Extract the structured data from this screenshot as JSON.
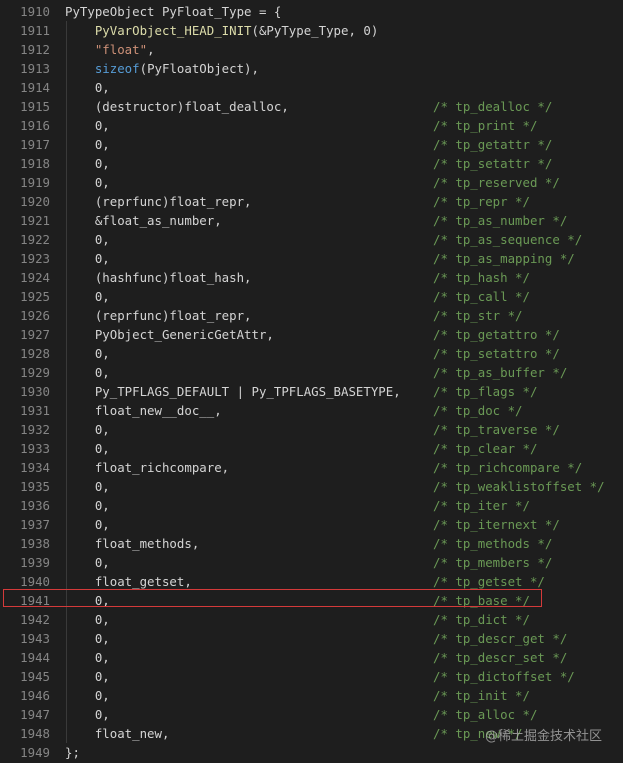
{
  "editor": {
    "lines": [
      {
        "num": "1910",
        "code": "PyTypeObject PyFloat_Type = {",
        "comment": ""
      },
      {
        "num": "1911",
        "code": "    PyVarObject_HEAD_INIT(&PyType_Type, 0)",
        "comment": ""
      },
      {
        "num": "1912",
        "code": "    \"float\",",
        "comment": ""
      },
      {
        "num": "1913",
        "code": "    sizeof(PyFloatObject),",
        "comment": ""
      },
      {
        "num": "1914",
        "code": "    0,",
        "comment": ""
      },
      {
        "num": "1915",
        "code": "    (destructor)float_dealloc,",
        "comment": "/* tp_dealloc */"
      },
      {
        "num": "1916",
        "code": "    0,",
        "comment": "/* tp_print */"
      },
      {
        "num": "1917",
        "code": "    0,",
        "comment": "/* tp_getattr */"
      },
      {
        "num": "1918",
        "code": "    0,",
        "comment": "/* tp_setattr */"
      },
      {
        "num": "1919",
        "code": "    0,",
        "comment": "/* tp_reserved */"
      },
      {
        "num": "1920",
        "code": "    (reprfunc)float_repr,",
        "comment": "/* tp_repr */"
      },
      {
        "num": "1921",
        "code": "    &float_as_number,",
        "comment": "/* tp_as_number */"
      },
      {
        "num": "1922",
        "code": "    0,",
        "comment": "/* tp_as_sequence */"
      },
      {
        "num": "1923",
        "code": "    0,",
        "comment": "/* tp_as_mapping */"
      },
      {
        "num": "1924",
        "code": "    (hashfunc)float_hash,",
        "comment": "/* tp_hash */"
      },
      {
        "num": "1925",
        "code": "    0,",
        "comment": "/* tp_call */"
      },
      {
        "num": "1926",
        "code": "    (reprfunc)float_repr,",
        "comment": "/* tp_str */"
      },
      {
        "num": "1927",
        "code": "    PyObject_GenericGetAttr,",
        "comment": "/* tp_getattro */"
      },
      {
        "num": "1928",
        "code": "    0,",
        "comment": "/* tp_setattro */"
      },
      {
        "num": "1929",
        "code": "    0,",
        "comment": "/* tp_as_buffer */"
      },
      {
        "num": "1930",
        "code": "    Py_TPFLAGS_DEFAULT | Py_TPFLAGS_BASETYPE,",
        "comment": "/* tp_flags */"
      },
      {
        "num": "1931",
        "code": "    float_new__doc__,",
        "comment": "/* tp_doc */"
      },
      {
        "num": "1932",
        "code": "    0,",
        "comment": "/* tp_traverse */"
      },
      {
        "num": "1933",
        "code": "    0,",
        "comment": "/* tp_clear */"
      },
      {
        "num": "1934",
        "code": "    float_richcompare,",
        "comment": "/* tp_richcompare */"
      },
      {
        "num": "1935",
        "code": "    0,",
        "comment": "/* tp_weaklistoffset */"
      },
      {
        "num": "1936",
        "code": "    0,",
        "comment": "/* tp_iter */"
      },
      {
        "num": "1937",
        "code": "    0,",
        "comment": "/* tp_iternext */"
      },
      {
        "num": "1938",
        "code": "    float_methods,",
        "comment": "/* tp_methods */"
      },
      {
        "num": "1939",
        "code": "    0,",
        "comment": "/* tp_members */"
      },
      {
        "num": "1940",
        "code": "    float_getset,",
        "comment": "/* tp_getset */"
      },
      {
        "num": "1941",
        "code": "    0,",
        "comment": "/* tp_base */"
      },
      {
        "num": "1942",
        "code": "    0,",
        "comment": "/* tp_dict */"
      },
      {
        "num": "1943",
        "code": "    0,",
        "comment": "/* tp_descr_get */"
      },
      {
        "num": "1944",
        "code": "    0,",
        "comment": "/* tp_descr_set */"
      },
      {
        "num": "1945",
        "code": "    0,",
        "comment": "/* tp_dictoffset */"
      },
      {
        "num": "1946",
        "code": "    0,",
        "comment": "/* tp_init */"
      },
      {
        "num": "1947",
        "code": "    0,",
        "comment": "/* tp_alloc */"
      },
      {
        "num": "1948",
        "code": "    float_new,",
        "comment": "/* tp_new */"
      },
      {
        "num": "1949",
        "code": "};",
        "comment": ""
      }
    ],
    "highlighted_line": "1941",
    "highlight_color": "#d43a3a",
    "background": "#1e1e1e",
    "line_number_color": "#858585",
    "comment_color": "#6a9955",
    "string_color": "#ce9178",
    "keyword_color": "#569cd6",
    "macro_color": "#dcdcaa"
  },
  "watermark": "@稀土掘金技术社区"
}
